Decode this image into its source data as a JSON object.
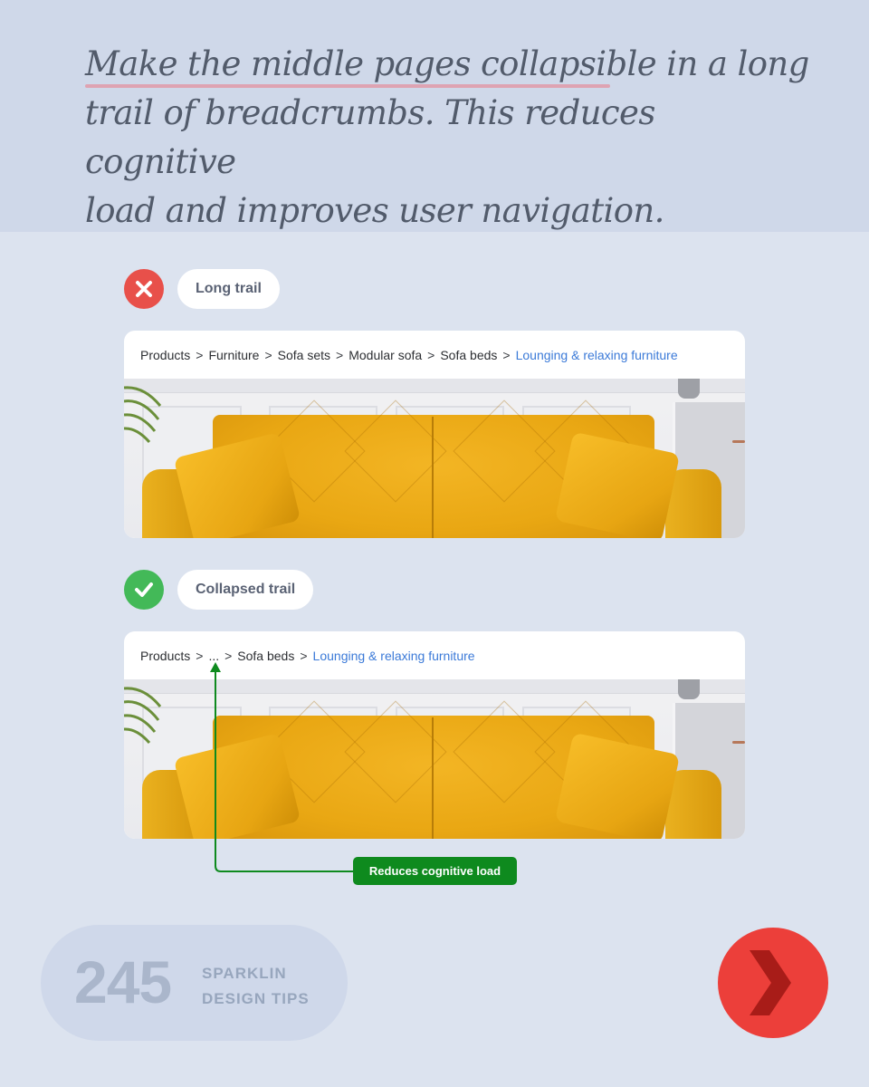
{
  "headline": {
    "highlighted": "Make the middle pages collapsible",
    "rest_line1": " in a long",
    "line2": "trail of breadcrumbs. This reduces cognitive",
    "line3": "load and improves user navigation."
  },
  "examples": [
    {
      "status": "bad",
      "status_icon": "x-icon",
      "label": "Long trail",
      "breadcrumbs": [
        "Products",
        "Furniture",
        "Sofa sets",
        "Modular sofa",
        "Sofa beds"
      ],
      "current": "Lounging & relaxing furniture",
      "separator": ">"
    },
    {
      "status": "good",
      "status_icon": "check-icon",
      "label": "Collapsed trail",
      "breadcrumbs": [
        "Products",
        "...",
        "Sofa beds"
      ],
      "current": "Lounging & relaxing furniture",
      "separator": ">"
    }
  ],
  "callout": {
    "text": "Reduces cognitive load"
  },
  "brand": {
    "number": "245",
    "line1": "SPARKLIN",
    "line2": "DESIGN TIPS"
  },
  "colors": {
    "bad": "#e8504a",
    "good": "#43b958",
    "link": "#3b7ad8",
    "callout": "#0e8a1e",
    "next": "#ec3f3a"
  }
}
